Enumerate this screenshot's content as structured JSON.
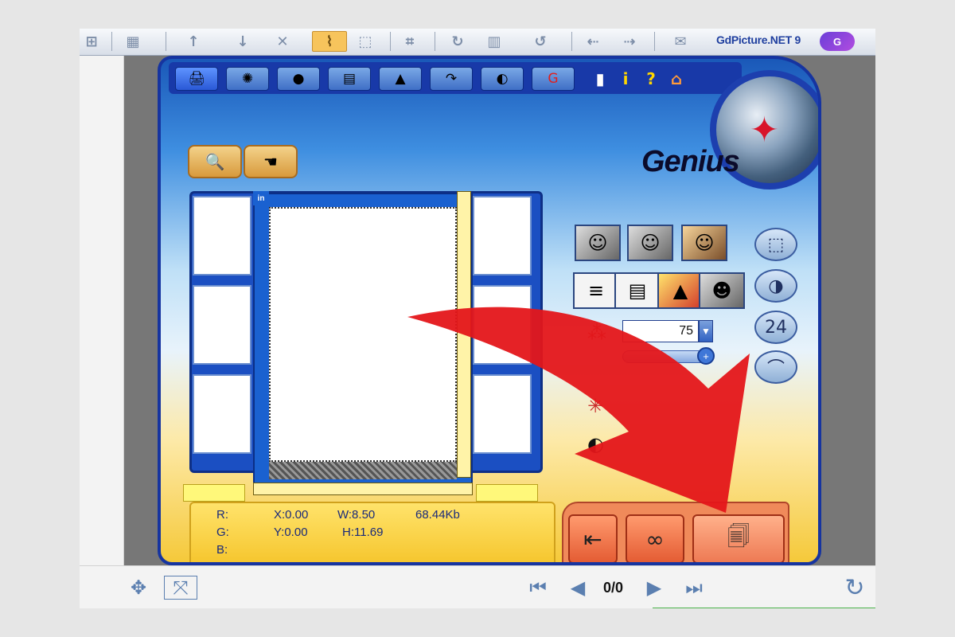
{
  "toolbar": {
    "brand": "GdPicture.NET 9",
    "brand_logo": "G",
    "icons": [
      "grid-icon",
      "up-arrow-icon",
      "down-arrow-icon",
      "close-icon",
      "lasso-icon",
      "select-rect-icon",
      "crop-icon",
      "rotate-icon",
      "columns-icon",
      "undo-icon",
      "arrow-left-icon",
      "arrow-right-icon",
      "comment-icon"
    ]
  },
  "app": {
    "brand": "Genius",
    "tools": [
      "scan-icon",
      "color-icon",
      "sphere-icon",
      "document-icon",
      "triangle-icon",
      "rotate-icon",
      "contrast-icon",
      "G"
    ],
    "mini_icons": [
      "settings-icon",
      "info-icon",
      "help-icon",
      "home-icon"
    ],
    "mini_glyphs": [
      "▮",
      "i",
      "?",
      "⌂"
    ],
    "tabs": [
      "zoom-icon",
      "hand-icon"
    ],
    "preview_tag": "in",
    "info": {
      "r": "R:",
      "g": "G:",
      "b": "B:",
      "x": "X:0.00",
      "y": "Y:0.00",
      "w": "W:8.50",
      "h": "H:11.69",
      "size": "68.44Kb"
    },
    "resolution": "75",
    "circ_24": "24",
    "photo_modes": [
      "line-art",
      "grayscale",
      "color"
    ],
    "doc_modes": [
      "text",
      "halftone",
      "chart",
      "photo"
    ]
  },
  "bottombar": {
    "page_count": "0/0"
  },
  "colors": {
    "arrow": "#e4161a",
    "frame_blue": "#1634a0"
  }
}
